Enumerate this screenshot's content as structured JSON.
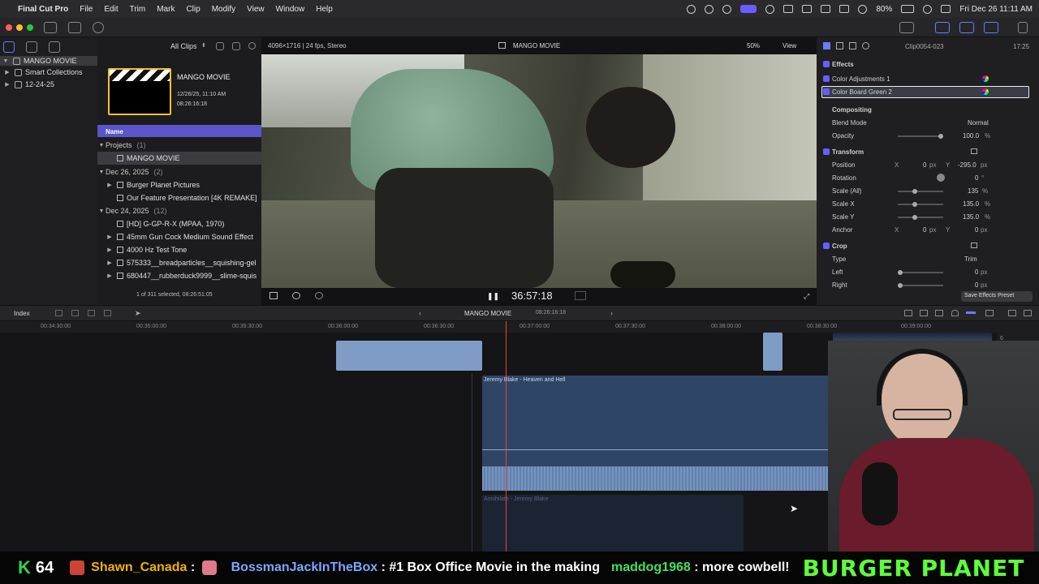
{
  "menubar": {
    "app": "Final Cut Pro",
    "items": [
      "File",
      "Edit",
      "Trim",
      "Mark",
      "Clip",
      "Modify",
      "View",
      "Window",
      "Help"
    ],
    "battery": "80%",
    "clock": "Fri Dec 26  11:11 AM"
  },
  "library": {
    "name": "MANGO MOVIE",
    "items": [
      "Smart Collections",
      "12-24-25"
    ]
  },
  "browser": {
    "filter": "All Clips",
    "project_name": "MANGO MOVIE",
    "project_date": "12/26/25, 11:10 AM",
    "project_duration": "08:26:16:18",
    "column_header": "Name",
    "status": "1 of 311 selected, 08:26:51:05",
    "rows": [
      {
        "kind": "group",
        "label": "Projects",
        "count": "(1)"
      },
      {
        "kind": "selected",
        "label": "MANGO MOVIE"
      },
      {
        "kind": "group",
        "label": "Dec 26, 2025",
        "count": "(2)"
      },
      {
        "kind": "item",
        "label": "Burger Planet Pictures"
      },
      {
        "kind": "item",
        "label": "Our Feature Presentation [4K REMAKE]"
      },
      {
        "kind": "group",
        "label": "Dec 24, 2025",
        "count": "(12)"
      },
      {
        "kind": "item",
        "label": "[HD] G-GP-R-X (MPAA, 1970)"
      },
      {
        "kind": "item",
        "label": "45mm Gun Cock Medium Sound Effect"
      },
      {
        "kind": "item",
        "label": "4000 Hz Test Tone"
      },
      {
        "kind": "item",
        "label": "575333__breadparticles__squishing-gel"
      },
      {
        "kind": "item",
        "label": "680447__rubberduck9999__slime-squis"
      }
    ]
  },
  "viewer": {
    "format": "4096×1716 | 24 fps, Stereo",
    "title": "MANGO MOVIE",
    "zoom": "50%",
    "view_label": "View",
    "timecode": "36:57:18"
  },
  "inspector": {
    "clip_name": "Clip0054-023",
    "duration": "17:25",
    "effects_label": "Effects",
    "effect1": "Color Adjustments 1",
    "effect2": "Color Board Green 2",
    "compositing": "Compositing",
    "blend_mode_label": "Blend Mode",
    "blend_mode_value": "Normal",
    "opacity_label": "Opacity",
    "opacity_value": "100.0",
    "transform_label": "Transform",
    "position_label": "Position",
    "position_x": "0",
    "position_y": "-295.0",
    "rotation_label": "Rotation",
    "rotation_value": "0",
    "scale_all_label": "Scale (All)",
    "scale_all_value": "135",
    "scale_x_label": "Scale X",
    "scale_x_value": "135.0",
    "scale_y_label": "Scale Y",
    "scale_y_value": "135.0",
    "anchor_label": "Anchor",
    "anchor_x": "0",
    "anchor_y": "0",
    "crop_label": "Crop",
    "type_label": "Type",
    "type_value": "Trim",
    "left_label": "Left",
    "left_value": "0",
    "right_label": "Right",
    "right_value": "0",
    "save_preset": "Save Effects Preset",
    "unit_px": "px",
    "unit_pct": "%",
    "unit_deg": "°",
    "x_label": "X",
    "y_label": "Y"
  },
  "timeline": {
    "index_label": "Index",
    "project": "MANGO MOVIE",
    "duration": "08:26:16:18",
    "ruler": [
      "00:34:30:00",
      "00:35:00:00",
      "00:35:30:00",
      "00:36:00:00",
      "00:36:30:00",
      "00:37:00:00",
      "00:37:30:00",
      "00:38:00:00",
      "00:38:30:00",
      "00:39:00:00"
    ],
    "music_clip": "Jeremy Blake - Heaven and Hell",
    "faded_clip": "Annihilate - Jeremy Blake",
    "meter_ticks": [
      "6",
      "0",
      "-6"
    ]
  },
  "stream": {
    "k_count": "64",
    "chat": [
      {
        "user": "Shawn_Canada",
        "sep": " : ",
        "msg": ""
      },
      {
        "user": "BossmanJackInTheBox",
        "sep": " : ",
        "msg": "#1 Box Office Movie in the making"
      },
      {
        "user": "maddog1968",
        "sep": " : ",
        "msg": "more cowbell!"
      }
    ],
    "brand": "BURGER PLANET"
  }
}
